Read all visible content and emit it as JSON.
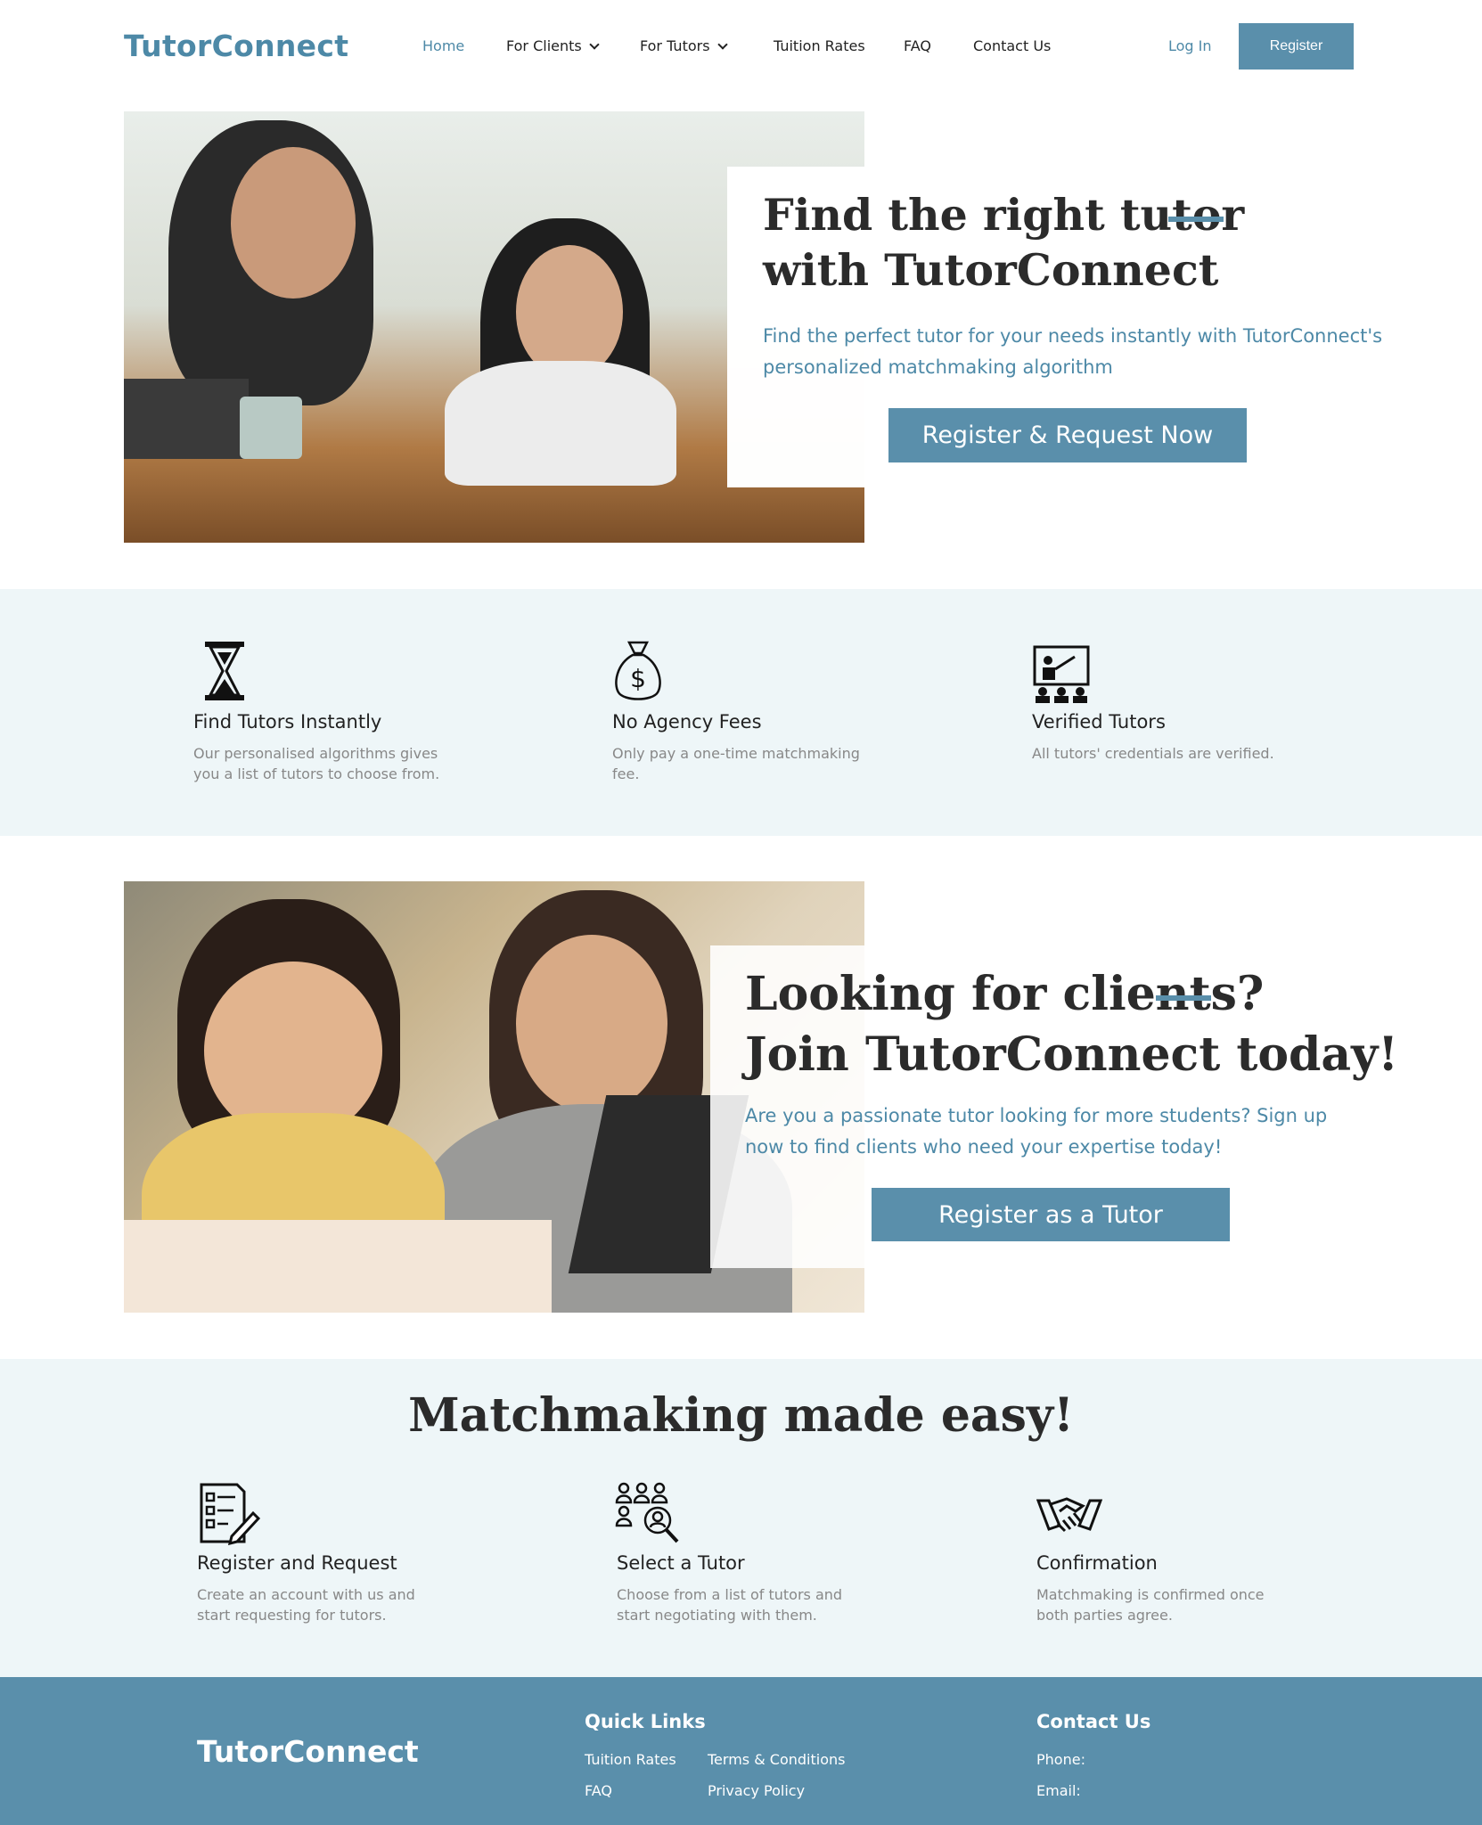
{
  "header": {
    "logo": "TutorConnect",
    "nav": {
      "home": "Home",
      "for_clients": "For Clients",
      "for_tutors": "For Tutors",
      "tuition_rates": "Tuition Rates",
      "faq": "FAQ",
      "contact": "Contact Us"
    },
    "login": "Log In",
    "register": "Register"
  },
  "hero": {
    "title_line1": "Find the right tutor",
    "title_line2": "with TutorConnect",
    "lead_line1": "Find the perfect tutor for your needs instantly with TutorConnect's",
    "lead_line2": "personalized matchmaking algorithm",
    "cta": "Register & Request Now"
  },
  "features": [
    {
      "icon": "hourglass-icon",
      "title": "Find Tutors Instantly",
      "text": "Our personalised algorithms gives you a list of tutors to choose from."
    },
    {
      "icon": "money-bag-icon",
      "title": "No Agency Fees",
      "text": "Only pay a one-time matchmaking fee."
    },
    {
      "icon": "teacher-board-icon",
      "title": "Verified Tutors",
      "text": "All tutors' credentials are verified."
    }
  ],
  "tutors": {
    "title_line1": "Looking for clients?",
    "title_line2": "Join TutorConnect today!",
    "lead_line1": "Are you a passionate tutor looking for more students? Sign up",
    "lead_line2": "now to find clients who need your expertise today!",
    "cta": "Register as a Tutor"
  },
  "steps_title": "Matchmaking made easy!",
  "steps": [
    {
      "icon": "checklist-pencil-icon",
      "title": "Register and Request",
      "text": "Create an account with us and start requesting for tutors."
    },
    {
      "icon": "people-search-icon",
      "title": "Select a Tutor",
      "text": "Choose from a list of tutors and start negotiating with them."
    },
    {
      "icon": "handshake-icon",
      "title": "Confirmation",
      "text": "Matchmaking is confirmed once both parties agree."
    }
  ],
  "footer": {
    "logo": "TutorConnect",
    "quick_links_title": "Quick Links",
    "links": [
      "Tuition Rates",
      "Terms & Conditions",
      "FAQ",
      "Privacy Policy"
    ],
    "contact_title": "Contact Us",
    "phone": "Phone:",
    "email": "Email:"
  },
  "colors": {
    "accent": "#5a8fab",
    "band": "#eef6f8",
    "footer": "#5a8fab"
  }
}
